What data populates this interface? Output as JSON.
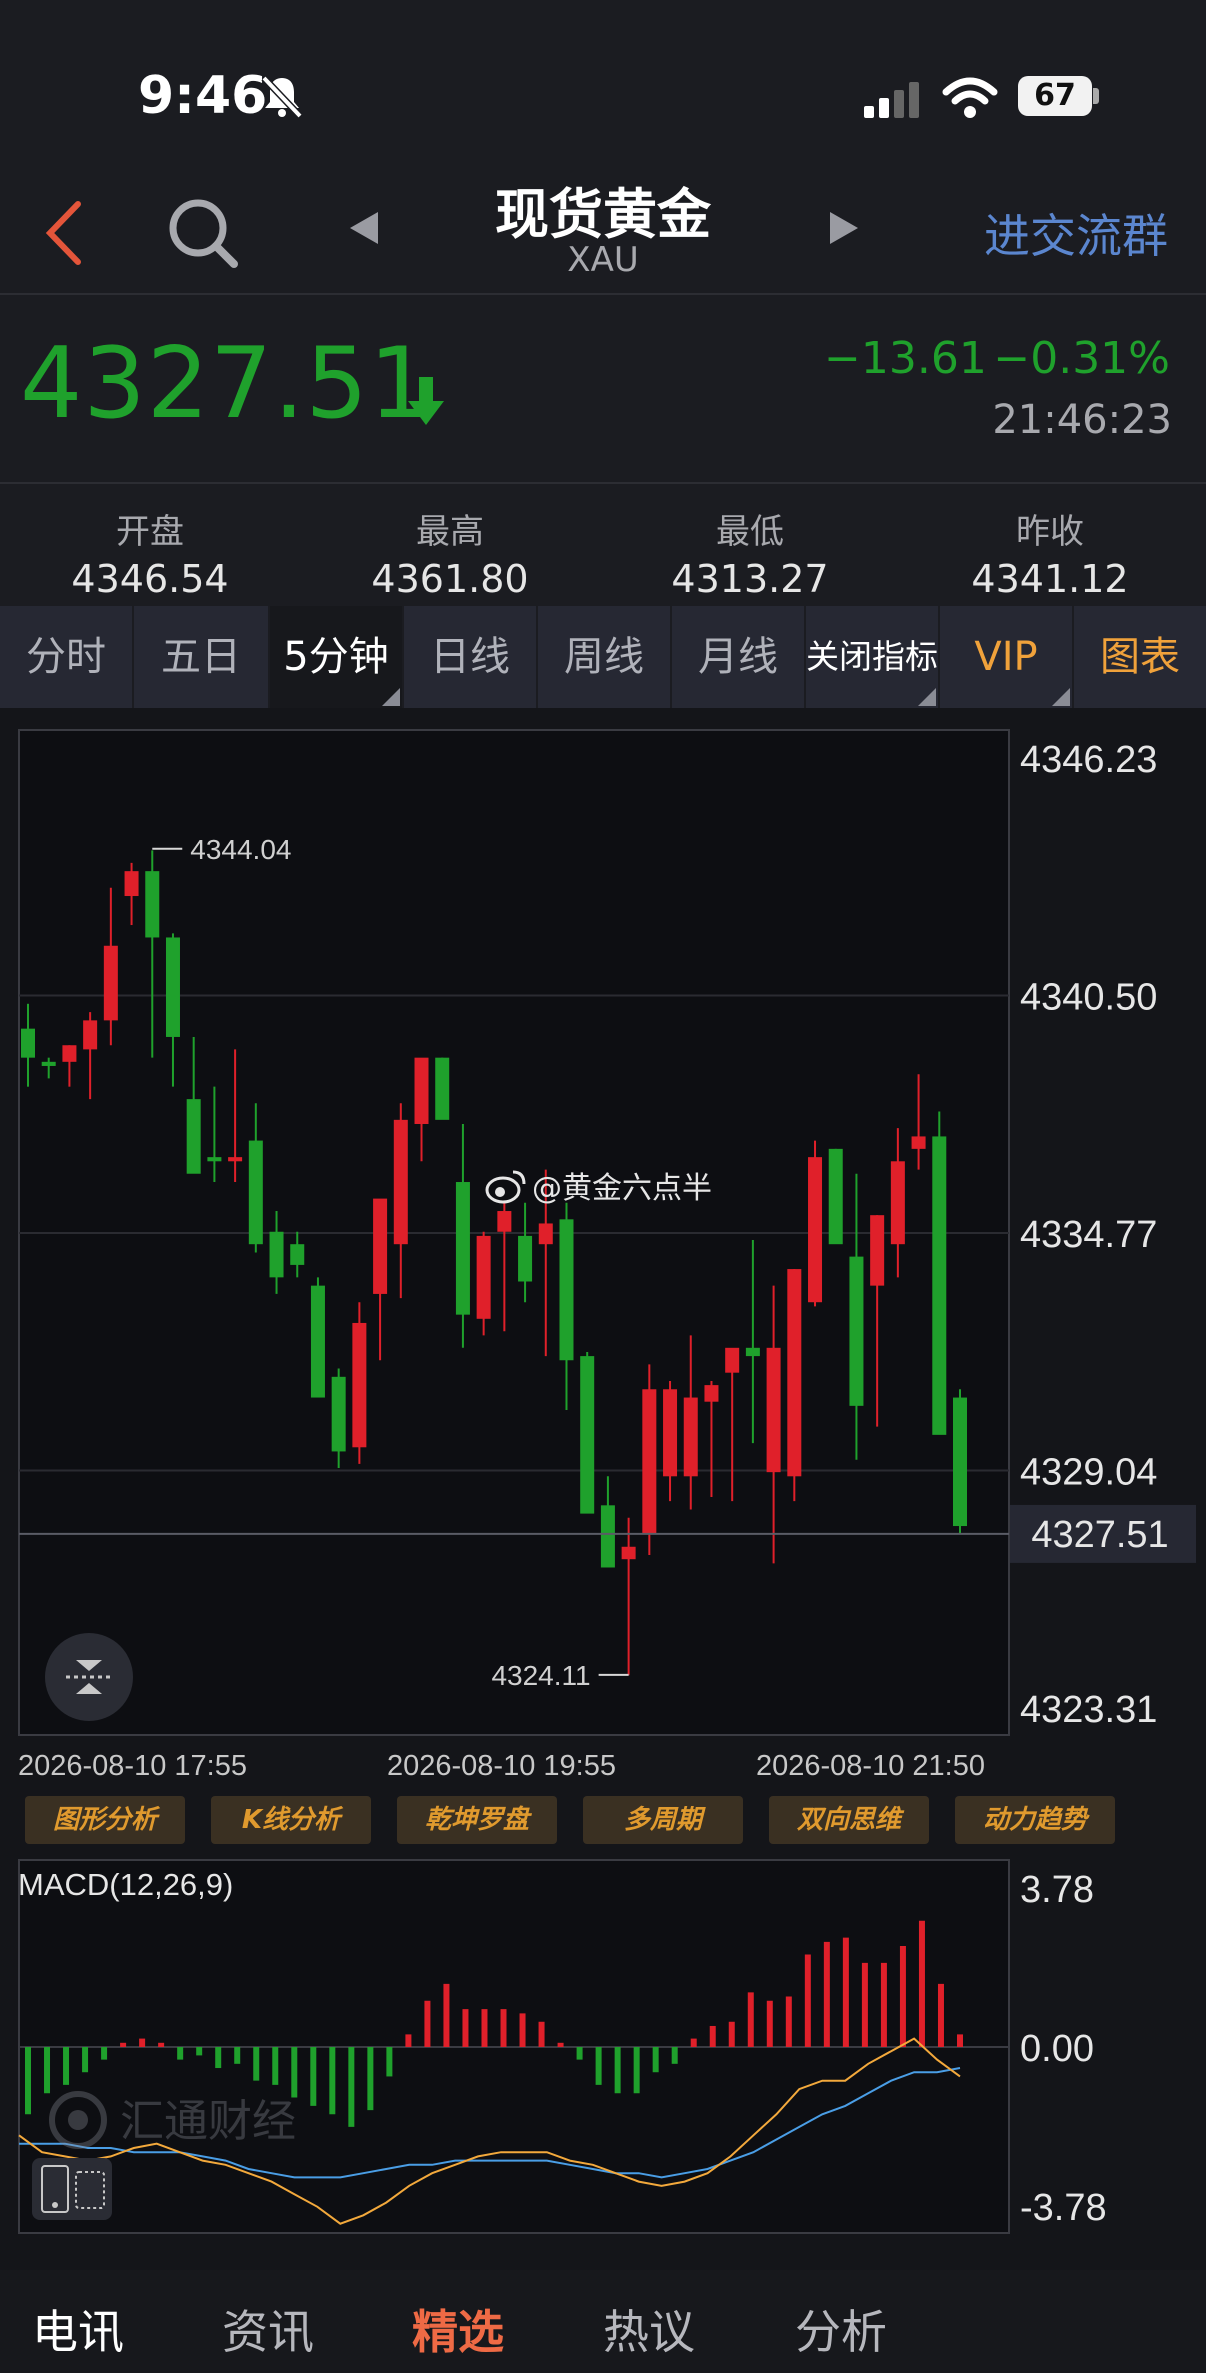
{
  "status": {
    "time": "9:46",
    "battery": "67"
  },
  "header": {
    "title": "现货黄金",
    "subtitle": "XAU",
    "join_group": "进交流群"
  },
  "quote": {
    "last": "4327.51",
    "change": "−13.61",
    "change_pct": "−0.31%",
    "time": "21:46:23",
    "direction": "down",
    "color_down": "#1fa12c",
    "color_up": "#e0202a"
  },
  "ohlc": [
    {
      "label": "开盘",
      "value": "4346.54"
    },
    {
      "label": "最高",
      "value": "4361.80"
    },
    {
      "label": "最低",
      "value": "4313.27"
    },
    {
      "label": "昨收",
      "value": "4341.12"
    }
  ],
  "tabs": [
    {
      "label": "分时",
      "active": false
    },
    {
      "label": "五日",
      "active": false
    },
    {
      "label": "5分钟",
      "active": true
    },
    {
      "label": "日线",
      "active": false
    },
    {
      "label": "周线",
      "active": false
    },
    {
      "label": "月线",
      "active": false
    },
    {
      "label": "关闭指标",
      "active": false
    },
    {
      "label": "VIP",
      "active": false
    },
    {
      "label": "图表",
      "active": false
    }
  ],
  "watermark": "@黄金六点半",
  "watermark2": "汇通财经",
  "chart_data": {
    "type": "candlestick",
    "y_ticks": [
      "4346.23",
      "4340.50",
      "4334.77",
      "4329.04",
      "4323.31"
    ],
    "current_price_label": "4327.51",
    "current_price": 4327.51,
    "ylim": [
      4323.31,
      4346.23
    ],
    "high_marker": "4344.04",
    "low_marker": "4324.11",
    "x_labels": [
      "2026-08-10 17:55",
      "2026-08-10 19:55",
      "2026-08-10 21:50"
    ],
    "candles": [
      [
        4339.7,
        4340.3,
        4338.3,
        4339.0
      ],
      [
        4338.9,
        4339.0,
        4338.5,
        4338.8
      ],
      [
        4338.9,
        4339.3,
        4338.3,
        4339.3
      ],
      [
        4339.2,
        4340.1,
        4338.0,
        4339.9
      ],
      [
        4339.9,
        4343.1,
        4339.3,
        4341.7
      ],
      [
        4342.9,
        4343.7,
        4342.2,
        4343.5
      ],
      [
        4343.5,
        4344.0,
        4339.0,
        4341.9
      ],
      [
        4341.9,
        4342.0,
        4338.3,
        4339.5
      ],
      [
        4338.0,
        4339.5,
        4337.0,
        4336.2
      ],
      [
        4336.6,
        4338.3,
        4336.0,
        4336.5
      ],
      [
        4336.5,
        4339.2,
        4336.0,
        4336.6
      ],
      [
        4337.0,
        4337.9,
        4334.3,
        4334.5
      ],
      [
        4334.8,
        4335.3,
        4333.3,
        4333.7
      ],
      [
        4334.5,
        4334.8,
        4333.7,
        4334.0
      ],
      [
        4333.5,
        4333.7,
        4331.4,
        4330.8
      ],
      [
        4331.3,
        4331.5,
        4329.1,
        4329.5
      ],
      [
        4329.6,
        4333.1,
        4329.2,
        4332.6
      ],
      [
        4333.3,
        4335.1,
        4331.7,
        4335.6
      ],
      [
        4334.5,
        4337.9,
        4333.2,
        4337.5
      ],
      [
        4337.4,
        4338.4,
        4336.5,
        4339.0
      ],
      [
        4339.0,
        4339.0,
        4337.6,
        4337.5
      ],
      [
        4336.0,
        4337.4,
        4332.0,
        4332.8
      ],
      [
        4332.7,
        4334.8,
        4332.3,
        4334.7
      ],
      [
        4334.8,
        4335.5,
        4332.4,
        4335.3
      ],
      [
        4334.7,
        4335.5,
        4333.1,
        4333.6
      ],
      [
        4334.5,
        4336.3,
        4331.8,
        4335.0
      ],
      [
        4335.1,
        4335.5,
        4330.5,
        4331.7
      ],
      [
        4331.8,
        4331.9,
        4328.4,
        4328.0
      ],
      [
        4328.2,
        4328.9,
        4327.3,
        4326.7
      ],
      [
        4326.9,
        4327.9,
        4324.1,
        4327.2
      ],
      [
        4327.5,
        4331.6,
        4327.0,
        4331.0
      ],
      [
        4328.9,
        4331.2,
        4328.3,
        4331.0
      ],
      [
        4328.9,
        4332.3,
        4328.1,
        4330.8
      ],
      [
        4330.7,
        4331.2,
        4328.4,
        4331.1
      ],
      [
        4331.4,
        4331.8,
        4328.3,
        4332.0
      ],
      [
        4332.0,
        4334.6,
        4329.7,
        4331.8
      ],
      [
        4329.0,
        4333.5,
        4326.8,
        4332.0
      ],
      [
        4328.9,
        4333.9,
        4328.3,
        4333.9
      ],
      [
        4333.1,
        4337.0,
        4333.0,
        4336.6
      ],
      [
        4336.8,
        4336.8,
        4335.7,
        4334.5
      ],
      [
        4334.2,
        4336.2,
        4329.3,
        4330.6
      ],
      [
        4333.5,
        4335.2,
        4330.1,
        4335.2
      ],
      [
        4334.5,
        4337.3,
        4333.7,
        4336.5
      ],
      [
        4336.8,
        4338.6,
        4336.3,
        4337.1
      ],
      [
        4337.1,
        4337.7,
        4332.3,
        4329.9
      ],
      [
        4330.8,
        4331.0,
        4327.5,
        4327.7
      ]
    ],
    "macd": {
      "label": "MACD(12,26,9)",
      "y_ticks": [
        "3.78",
        "0.00",
        "-3.78"
      ],
      "ylim": [
        -3.78,
        3.78
      ],
      "histogram": [
        -1.6,
        -1.1,
        -0.9,
        -0.6,
        -0.3,
        0.1,
        0.2,
        0.1,
        -0.3,
        -0.2,
        -0.5,
        -0.4,
        -0.8,
        -0.9,
        -1.2,
        -1.4,
        -1.6,
        -1.9,
        -1.5,
        -0.7,
        0.3,
        1.1,
        1.5,
        0.9,
        0.9,
        0.9,
        0.8,
        0.6,
        0.1,
        -0.3,
        -0.9,
        -1.1,
        -1.1,
        -0.6,
        -0.4,
        0.2,
        0.5,
        0.6,
        1.3,
        1.1,
        1.2,
        2.2,
        2.5,
        2.6,
        2.0,
        2.0,
        2.4,
        3.0,
        1.5,
        0.3
      ],
      "dif": [
        -2.1,
        -2.5,
        -2.6,
        -2.7,
        -2.6,
        -2.4,
        -2.3,
        -2.5,
        -2.7,
        -2.8,
        -3.0,
        -3.2,
        -3.5,
        -3.8,
        -4.2,
        -4.0,
        -3.7,
        -3.3,
        -3.0,
        -2.8,
        -2.6,
        -2.5,
        -2.5,
        -2.5,
        -2.7,
        -2.8,
        -3.0,
        -3.2,
        -3.3,
        -3.2,
        -3.0,
        -2.6,
        -2.1,
        -1.6,
        -1.0,
        -0.8,
        -0.8,
        -0.4,
        -0.1,
        0.2,
        -0.3,
        -0.7
      ],
      "dea": [
        -2.3,
        -2.3,
        -2.3,
        -2.4,
        -2.4,
        -2.5,
        -2.5,
        -2.5,
        -2.6,
        -2.7,
        -2.9,
        -3.0,
        -3.1,
        -3.1,
        -3.1,
        -3.0,
        -2.9,
        -2.8,
        -2.8,
        -2.7,
        -2.7,
        -2.7,
        -2.7,
        -2.7,
        -2.8,
        -2.9,
        -3.0,
        -3.0,
        -3.1,
        -3.0,
        -2.9,
        -2.7,
        -2.5,
        -2.2,
        -1.9,
        -1.6,
        -1.4,
        -1.1,
        -0.8,
        -0.6,
        -0.6,
        -0.5
      ],
      "color_dif": "#f3a93c",
      "color_dea": "#4a9ee6"
    }
  },
  "tools": [
    "图形分析",
    "K线分析",
    "乾坤罗盘",
    "多周期",
    "双向思维",
    "动力趋势"
  ],
  "nav": [
    {
      "label": "电讯",
      "state": "white"
    },
    {
      "label": "资讯",
      "state": "normal"
    },
    {
      "label": "精选",
      "state": "red"
    },
    {
      "label": "热议",
      "state": "normal"
    },
    {
      "label": "分析",
      "state": "normal"
    }
  ]
}
